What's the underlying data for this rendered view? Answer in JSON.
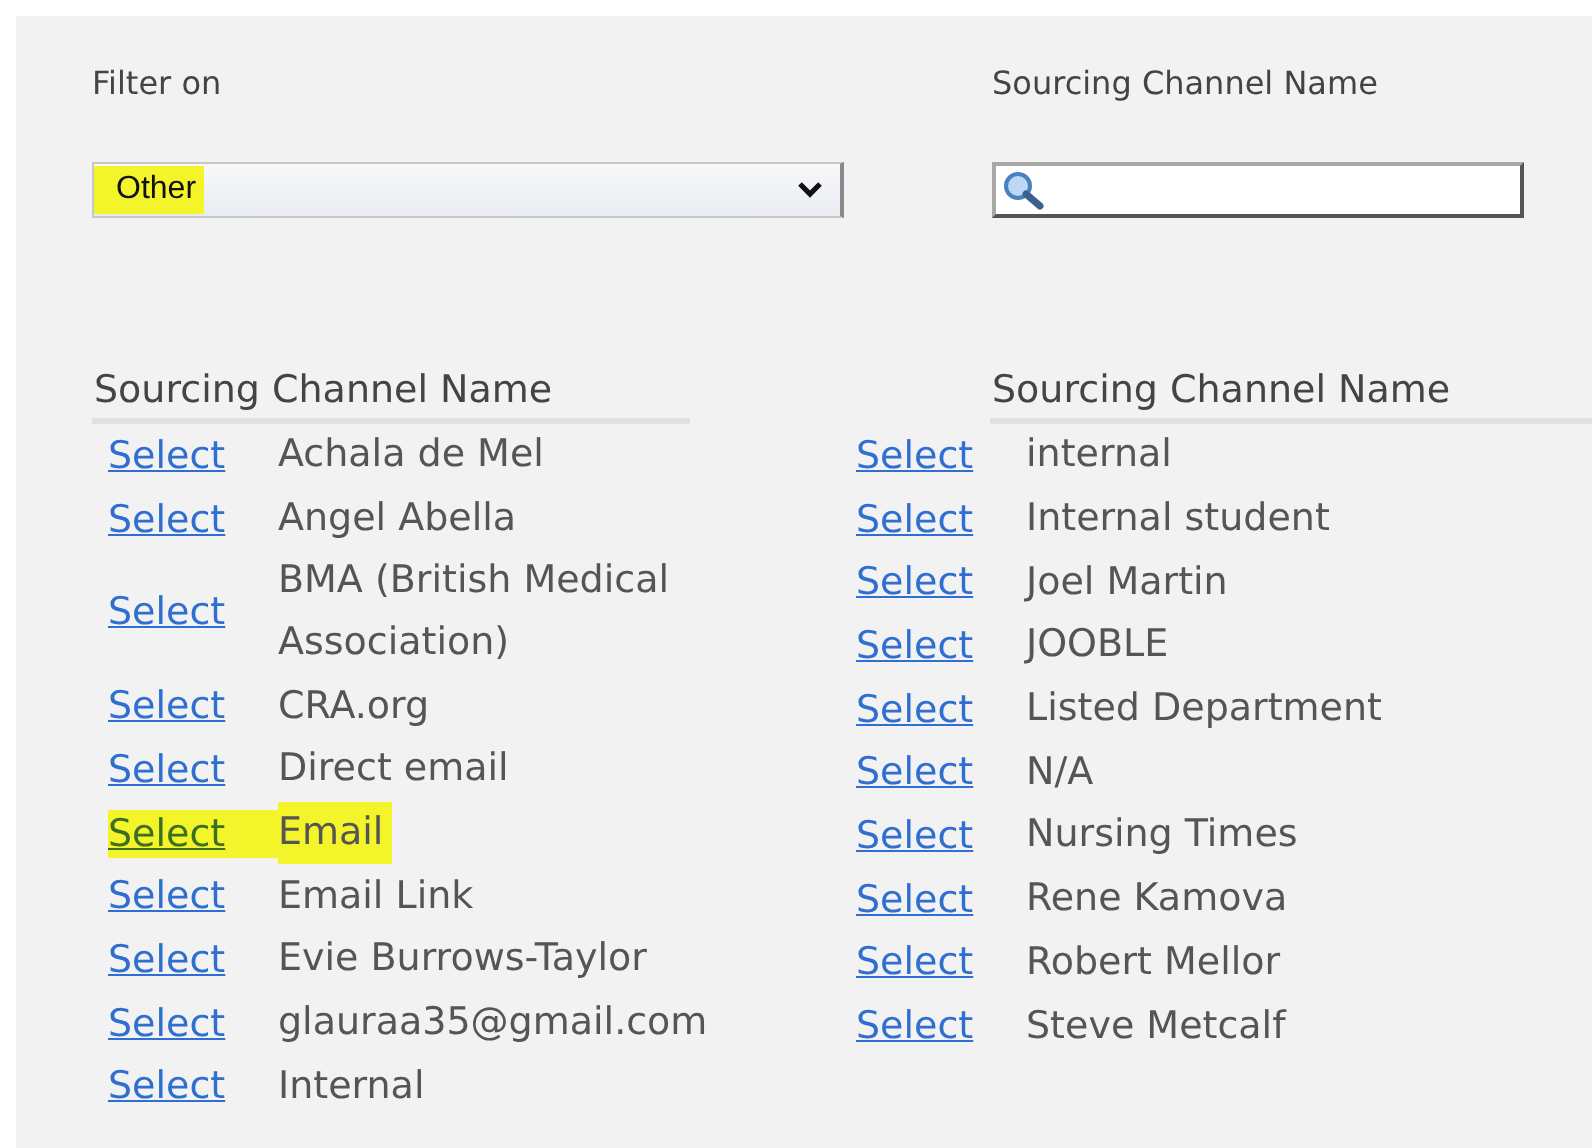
{
  "filter": {
    "label": "Filter on",
    "value": "Other",
    "highlighted": true
  },
  "search": {
    "label": "Sourcing Channel Name"
  },
  "tables": [
    {
      "header": "Sourcing Channel Name",
      "rows": [
        {
          "action": "Select",
          "name": "Achala de Mel",
          "highlighted": false
        },
        {
          "action": "Select",
          "name": "Angel Abella",
          "highlighted": false
        },
        {
          "action": "Select",
          "name": "BMA (British Medical Association)",
          "highlighted": false
        },
        {
          "action": "Select",
          "name": "CRA.org",
          "highlighted": false
        },
        {
          "action": "Select",
          "name": "Direct email",
          "highlighted": false
        },
        {
          "action": "Select",
          "name": "Email",
          "highlighted": true
        },
        {
          "action": "Select",
          "name": "Email Link",
          "highlighted": false
        },
        {
          "action": "Select",
          "name": "Evie Burrows-Taylor",
          "highlighted": false
        },
        {
          "action": "Select",
          "name": "glauraa35@gmail.com",
          "highlighted": false
        },
        {
          "action": "Select",
          "name": "Internal",
          "highlighted": false
        }
      ]
    },
    {
      "header": "Sourcing Channel Name",
      "rows": [
        {
          "action": "Select",
          "name": "internal",
          "highlighted": false
        },
        {
          "action": "Select",
          "name": "Internal student",
          "highlighted": false
        },
        {
          "action": "Select",
          "name": "Joel Martin",
          "highlighted": false
        },
        {
          "action": "Select",
          "name": "JOOBLE",
          "highlighted": false
        },
        {
          "action": "Select",
          "name": "Listed Department",
          "highlighted": false
        },
        {
          "action": "Select",
          "name": "N/A",
          "highlighted": false
        },
        {
          "action": "Select",
          "name": "Nursing Times",
          "highlighted": false
        },
        {
          "action": "Select",
          "name": "Rene Kamova",
          "highlighted": false
        },
        {
          "action": "Select",
          "name": "Robert Mellor",
          "highlighted": false
        },
        {
          "action": "Select",
          "name": "Steve Metcalf",
          "highlighted": false
        }
      ]
    }
  ]
}
